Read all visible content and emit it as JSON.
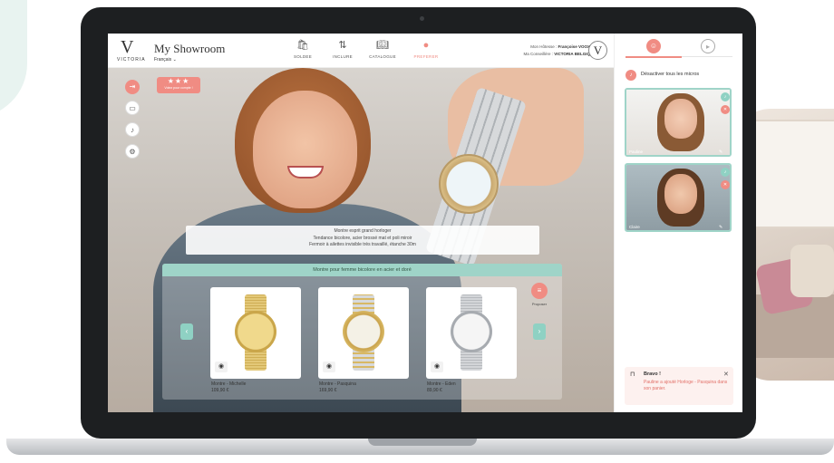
{
  "app": {
    "brand": "VICTORIA",
    "logo_letter": "V",
    "title": "My Showroom",
    "language": "Français"
  },
  "nav": [
    {
      "label": "SOLDEE",
      "icon": "bag-icon"
    },
    {
      "label": "INCLURE",
      "icon": "sort-arrows-icon"
    },
    {
      "label": "CATALOGUE",
      "icon": "book-icon"
    },
    {
      "label": "PREFERER",
      "icon": "pin-icon"
    }
  ],
  "host": {
    "hostess_label": "Mon Hôtesse :",
    "hostess_name": "Françoise VOOX",
    "advisor_label": "Ma Conseillère :",
    "advisor_name": "VICTORIA BELGIQ"
  },
  "rating": {
    "stars": "★★★",
    "text": "Votez pour compte !"
  },
  "caption": [
    "Montre esprit grand horloger",
    "Tendance bicolore, acier brossé mat et poli miroir",
    "Fermoir à ailettes invisible très travaillé, étanche 30m"
  ],
  "products": {
    "header": "Montre pour femme bicolore en acier et doré",
    "propose_label": "Proposer",
    "items": [
      {
        "name": "Montre - Michelle",
        "price": "109,90 €"
      },
      {
        "name": "Montre - Pasquina",
        "price": "169,90 €"
      },
      {
        "name": "Montre - Eden",
        "price": "89,90 €"
      }
    ]
  },
  "sidebar": {
    "mute_all": "Désactiver tous les micros",
    "guests": [
      {
        "name": "Pauline"
      },
      {
        "name": "Claire"
      }
    ]
  },
  "toast": {
    "title": "Bravo !",
    "message": "Pauline a ajouté Horloge - Pasquina dans son panier."
  },
  "colors": {
    "accent": "#f08c83",
    "mint": "#9fd4c8"
  }
}
